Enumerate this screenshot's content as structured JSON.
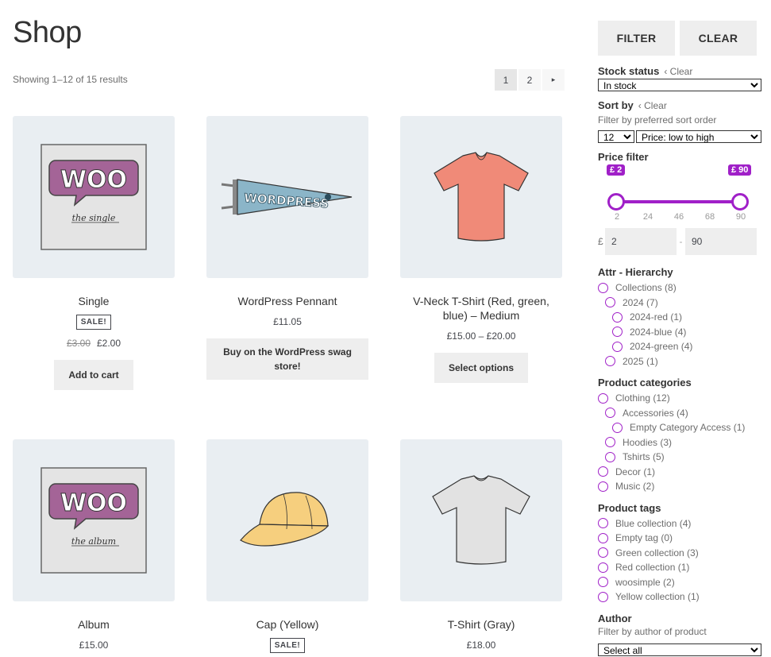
{
  "page": {
    "title": "Shop",
    "result_count": "Showing 1–12 of 15 results"
  },
  "pagination": {
    "pages": [
      "1",
      "2"
    ],
    "next": "▸"
  },
  "products": [
    {
      "name": "Single",
      "badge": "SALE!",
      "old_price": "£3.00",
      "price": "£2.00",
      "button": "Add to cart"
    },
    {
      "name": "WordPress Pennant",
      "price": "£11.05",
      "button": "Buy on the WordPress swag store!"
    },
    {
      "name": "V-Neck T-Shirt (Red, green, blue) – Medium",
      "price": "£15.00 – £20.00",
      "button": "Select options"
    },
    {
      "name": "Album",
      "price": "£15.00"
    },
    {
      "name": "Cap (Yellow)",
      "badge": "SALE!"
    },
    {
      "name": "T-Shirt (Gray)",
      "price": "£18.00"
    }
  ],
  "sidebar": {
    "filter_label": "FILTER",
    "clear_label": "CLEAR",
    "stock": {
      "title": "Stock status",
      "clear": "Clear",
      "selected": "In stock"
    },
    "sort": {
      "title": "Sort by",
      "clear": "Clear",
      "desc": "Filter by preferred sort order",
      "per_page": "12",
      "order": "Price: low to high"
    },
    "price": {
      "title": "Price filter",
      "min_tip": "£ 2",
      "max_tip": "£ 90",
      "scale": [
        "2",
        "24",
        "46",
        "68",
        "90"
      ],
      "currency": "£",
      "min": "2",
      "max": "90",
      "sep": "-"
    },
    "attr": {
      "title": "Attr - Hierarchy",
      "items": [
        "Collections (8)",
        "2024 (7)",
        "2024-red (1)",
        "2024-blue (4)",
        "2024-green (4)",
        "2025 (1)"
      ]
    },
    "categories": {
      "title": "Product categories",
      "items": [
        "Clothing (12)",
        "Accessories (4)",
        "Empty Category Access (1)",
        "Hoodies (3)",
        "Tshirts (5)",
        "Decor (1)",
        "Music (2)"
      ]
    },
    "tags": {
      "title": "Product tags",
      "items": [
        "Blue collection (4)",
        "Empty tag (0)",
        "Green collection (3)",
        "Red collection (1)",
        "woosimple (2)",
        "Yellow collection (1)"
      ]
    },
    "author": {
      "title": "Author",
      "desc": "Filter by author of product",
      "selected": "Select all"
    }
  }
}
